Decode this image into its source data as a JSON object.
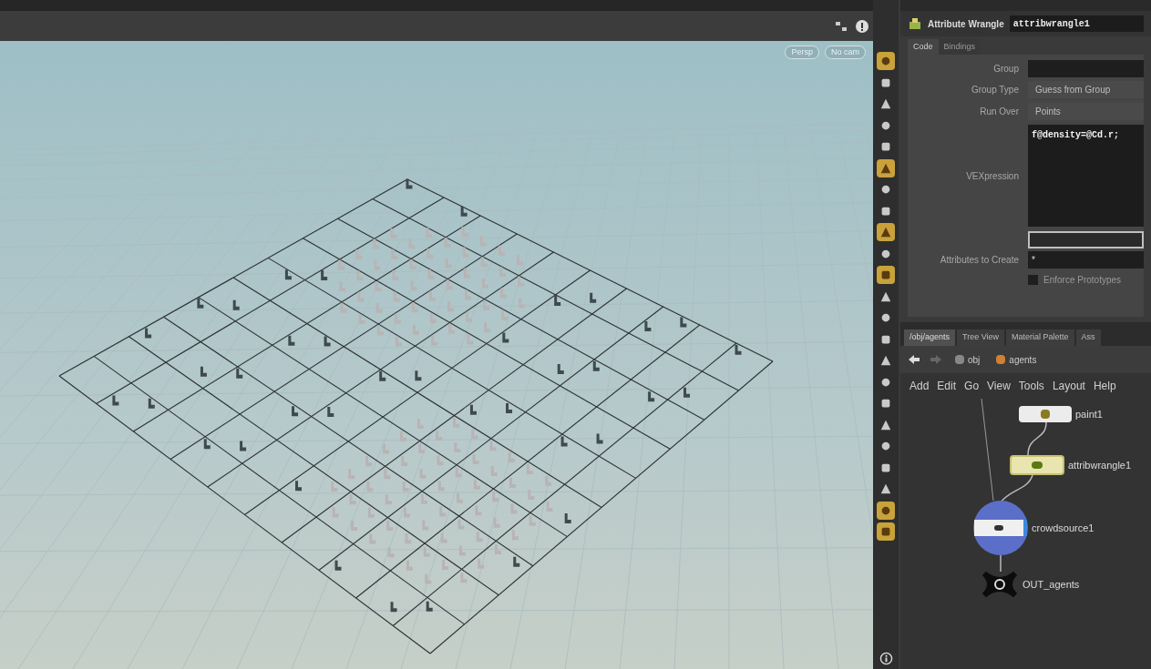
{
  "viewport": {
    "camera_menus": [
      "Persp",
      "No cam"
    ]
  },
  "viewport_tools": [
    {
      "active": true
    },
    {
      "active": false
    },
    {
      "active": false
    },
    {
      "active": false
    },
    {
      "active": false
    },
    {
      "active": true
    },
    {
      "active": false
    },
    {
      "active": false
    },
    {
      "active": true
    },
    {
      "active": false
    },
    {
      "active": true
    },
    {
      "active": false
    },
    {
      "active": false
    },
    {
      "active": false
    },
    {
      "active": false
    },
    {
      "active": false
    },
    {
      "active": false
    },
    {
      "active": false
    },
    {
      "active": false
    },
    {
      "active": false
    },
    {
      "active": false
    },
    {
      "active": true
    },
    {
      "active": true
    }
  ],
  "parameter_panel": {
    "node_type": "Attribute Wrangle",
    "node_name": "attribwrangle1",
    "tabs": [
      {
        "label": "Code",
        "selected": true
      },
      {
        "label": "Bindings",
        "selected": false
      }
    ],
    "params": [
      {
        "kind": "field",
        "label": "Group"
      },
      {
        "kind": "menu",
        "label": "Group Type",
        "value": "Guess from Group"
      },
      {
        "kind": "menu",
        "label": "Run Over",
        "value": "Points"
      },
      {
        "kind": "code",
        "label": "VEXpression",
        "value": "f@density=@Cd.r;"
      },
      {
        "kind": "field"
      },
      {
        "kind": "field",
        "label": "Attributes to Create",
        "value": "*"
      },
      {
        "kind": "checkbox",
        "label": "Enforce Prototypes",
        "checked": false
      }
    ]
  },
  "network_panel": {
    "tabs": [
      {
        "label": "/obj/agents",
        "selected": true
      },
      {
        "label": "Tree View",
        "selected": false
      },
      {
        "label": "Material Palette",
        "selected": false
      },
      {
        "label": "Ass",
        "selected": false
      }
    ],
    "path": [
      "obj",
      "agents"
    ],
    "menu": [
      "Add",
      "Edit",
      "Go",
      "View",
      "Tools",
      "Layout",
      "Help"
    ],
    "nodes": [
      {
        "kind": "paint",
        "name": "paint1"
      },
      {
        "kind": "wrangle",
        "name": "attribwrangle1"
      },
      {
        "kind": "crowdsource",
        "name": "crowdsource1"
      },
      {
        "kind": "null",
        "name": "OUT_agents"
      }
    ]
  }
}
